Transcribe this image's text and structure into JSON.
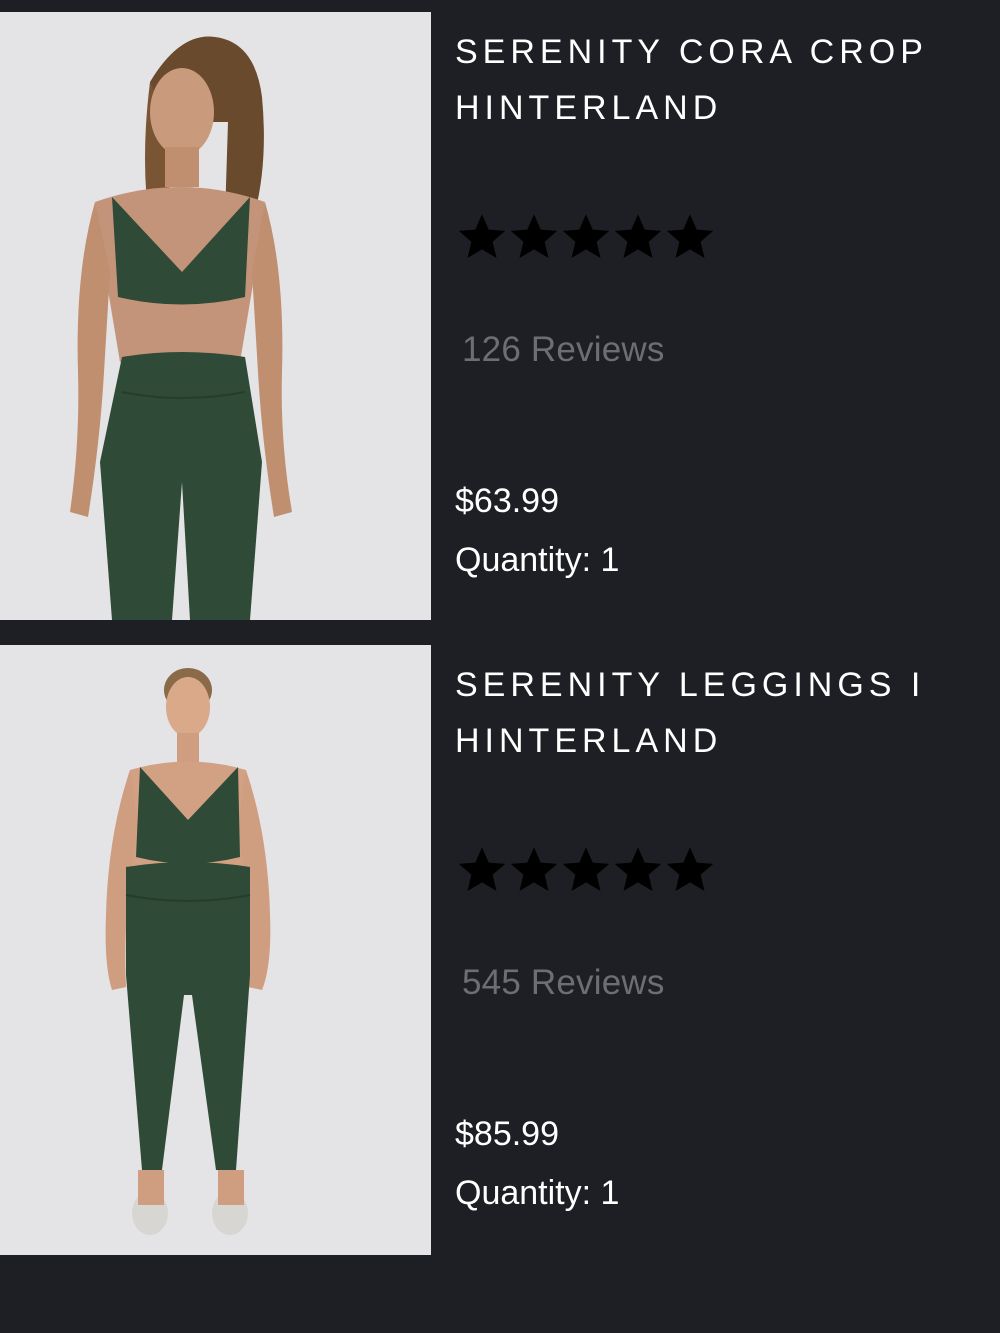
{
  "colors": {
    "background": "#1e1f24",
    "photo_background": "#e4e3e5",
    "garment_green": "#2f4a36",
    "review_text": "#6d6e73",
    "star": "#000000"
  },
  "products": [
    {
      "title_line1": "SERENITY CORA CROP",
      "title_line2": "HINTERLAND",
      "rating_stars": 5,
      "reviews": "126 Reviews",
      "price": "$63.99",
      "quantity": "Quantity: 1",
      "image_icon": "product-photo-crop-top"
    },
    {
      "title_line1": "SERENITY LEGGINGS I",
      "title_line2": "HINTERLAND",
      "rating_stars": 5,
      "reviews": "545 Reviews",
      "price": "$85.99",
      "quantity": "Quantity: 1",
      "image_icon": "product-photo-leggings"
    }
  ]
}
